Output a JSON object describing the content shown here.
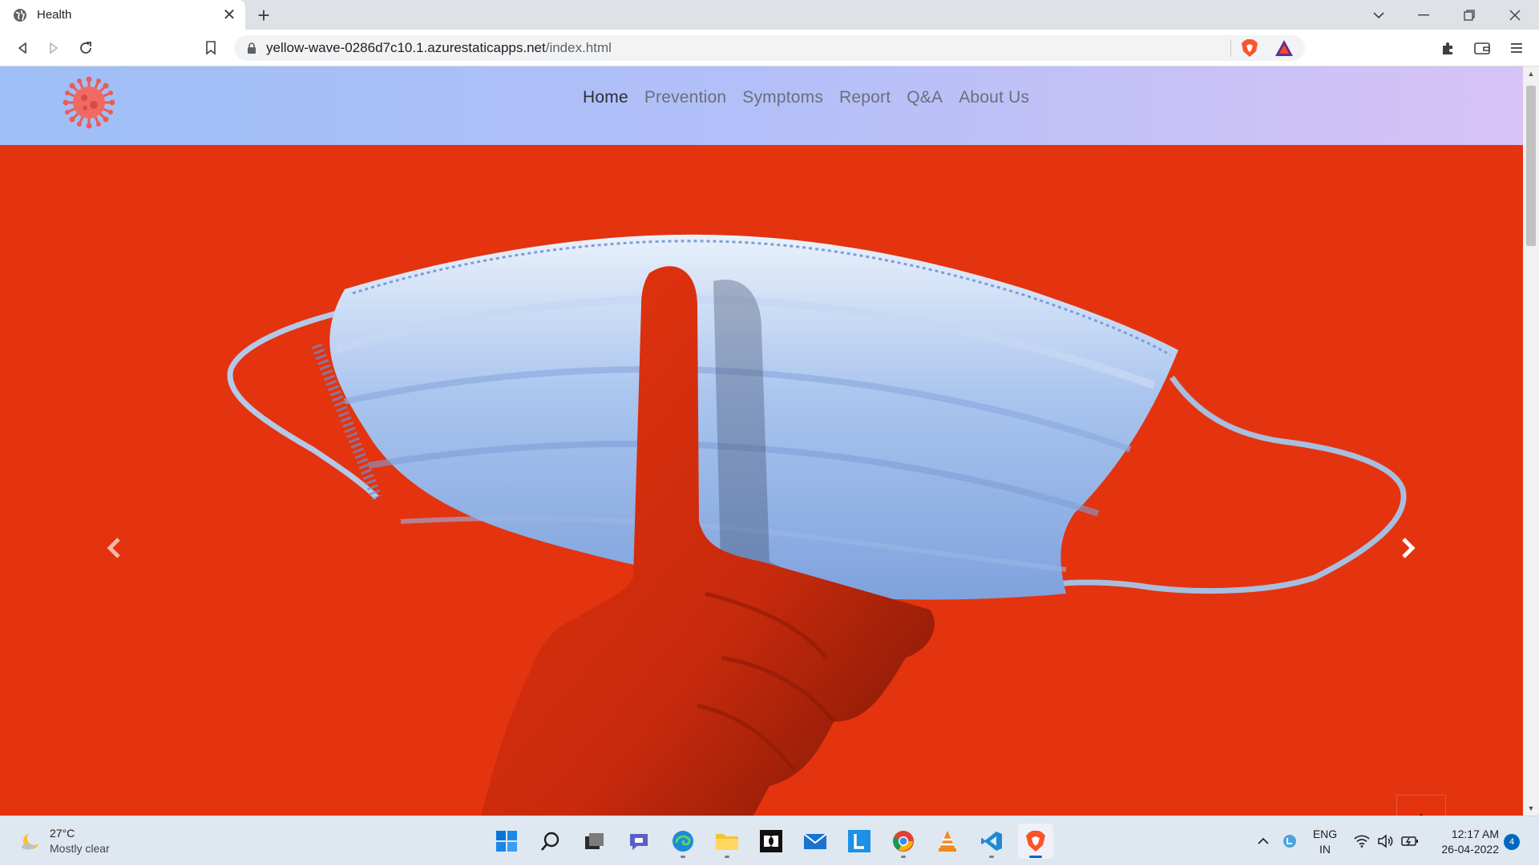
{
  "browser": {
    "tab_title": "Health",
    "url_host": "yellow-wave-0286d7c10.1.azurestaticapps.net",
    "url_path": "/index.html"
  },
  "site": {
    "nav": [
      {
        "label": "Home",
        "active": true
      },
      {
        "label": "Prevention"
      },
      {
        "label": "Symptoms"
      },
      {
        "label": "Report"
      },
      {
        "label": "Q&A"
      },
      {
        "label": "About Us"
      }
    ],
    "colors": {
      "hero_bg": "#e4330f",
      "header_start": "#9ebff7",
      "header_end": "#d7c3f6"
    }
  },
  "taskbar": {
    "weather_temp": "27°C",
    "weather_desc": "Mostly clear",
    "lang_line1": "ENG",
    "lang_line2": "IN",
    "time": "12:17 AM",
    "date": "26-04-2022",
    "notification_count": "4",
    "apps": [
      "start-icon",
      "search-icon",
      "task-view-icon",
      "chat-icon",
      "edge-icon",
      "file-explorer-icon",
      "dolby-icon",
      "mail-icon",
      "l-app-icon",
      "chrome-icon",
      "vlc-icon",
      "vscode-icon",
      "brave-icon"
    ]
  }
}
